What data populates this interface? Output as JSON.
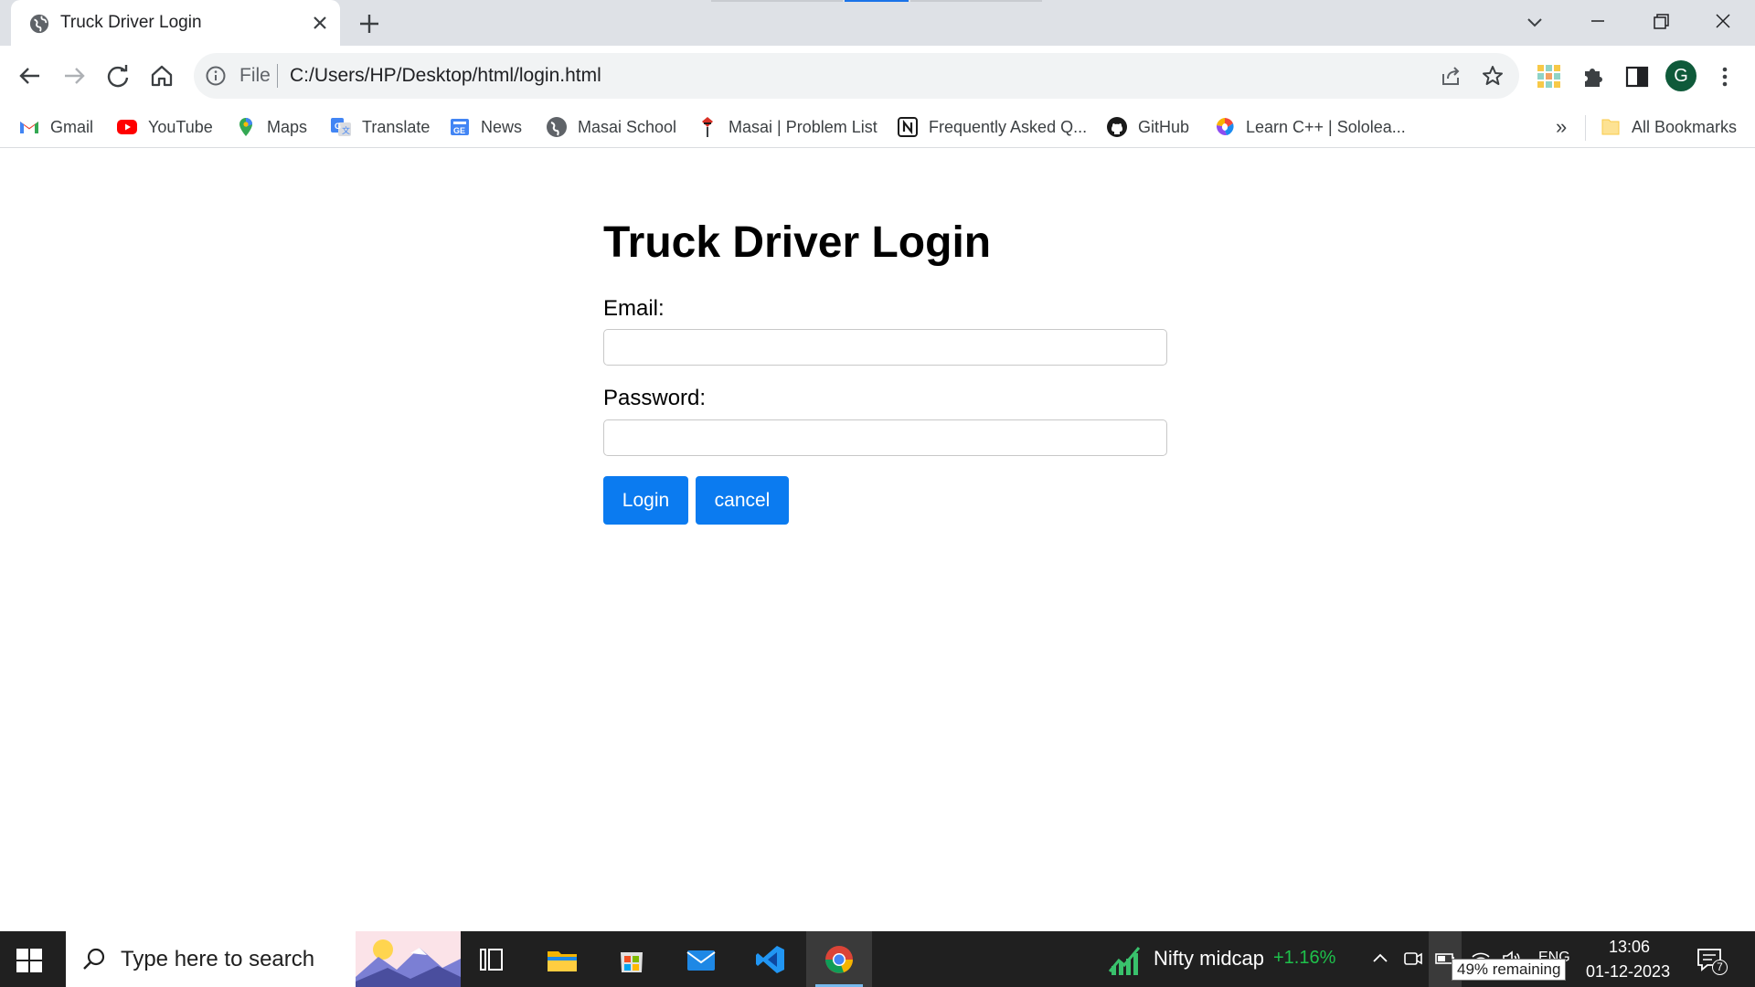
{
  "browser": {
    "tab_title": "Truck Driver Login",
    "address_scheme": "File",
    "address_url": "C:/Users/HP/Desktop/html/login.html",
    "profile_initial": "G",
    "bookmarks": [
      {
        "label": "Gmail",
        "icon": "gmail-icon"
      },
      {
        "label": "YouTube",
        "icon": "youtube-icon"
      },
      {
        "label": "Maps",
        "icon": "maps-icon"
      },
      {
        "label": "Translate",
        "icon": "translate-icon"
      },
      {
        "label": "News",
        "icon": "news-icon"
      },
      {
        "label": "Masai School",
        "icon": "globe-icon"
      },
      {
        "label": "Masai | Problem List",
        "icon": "masai-icon"
      },
      {
        "label": "Frequently Asked Q...",
        "icon": "notion-icon"
      },
      {
        "label": "GitHub",
        "icon": "github-icon"
      },
      {
        "label": "Learn C++ | Sololea...",
        "icon": "sololearn-icon"
      }
    ],
    "overflow_chevron": "»",
    "all_bookmarks_label": "All Bookmarks"
  },
  "page": {
    "title": "Truck Driver Login",
    "email_label": "Email:",
    "email_value": "",
    "password_label": "Password:",
    "password_value": "",
    "login_button": "Login",
    "cancel_button": "cancel",
    "button_color": "#0b7bf0"
  },
  "taskbar": {
    "search_placeholder": "Type here to search",
    "stock_name": "Nifty midcap",
    "stock_change": "+1.16%",
    "language": "ENG",
    "time": "13:06",
    "date": "01-12-2023",
    "notification_count": "7",
    "battery_tooltip": "49% remaining"
  }
}
